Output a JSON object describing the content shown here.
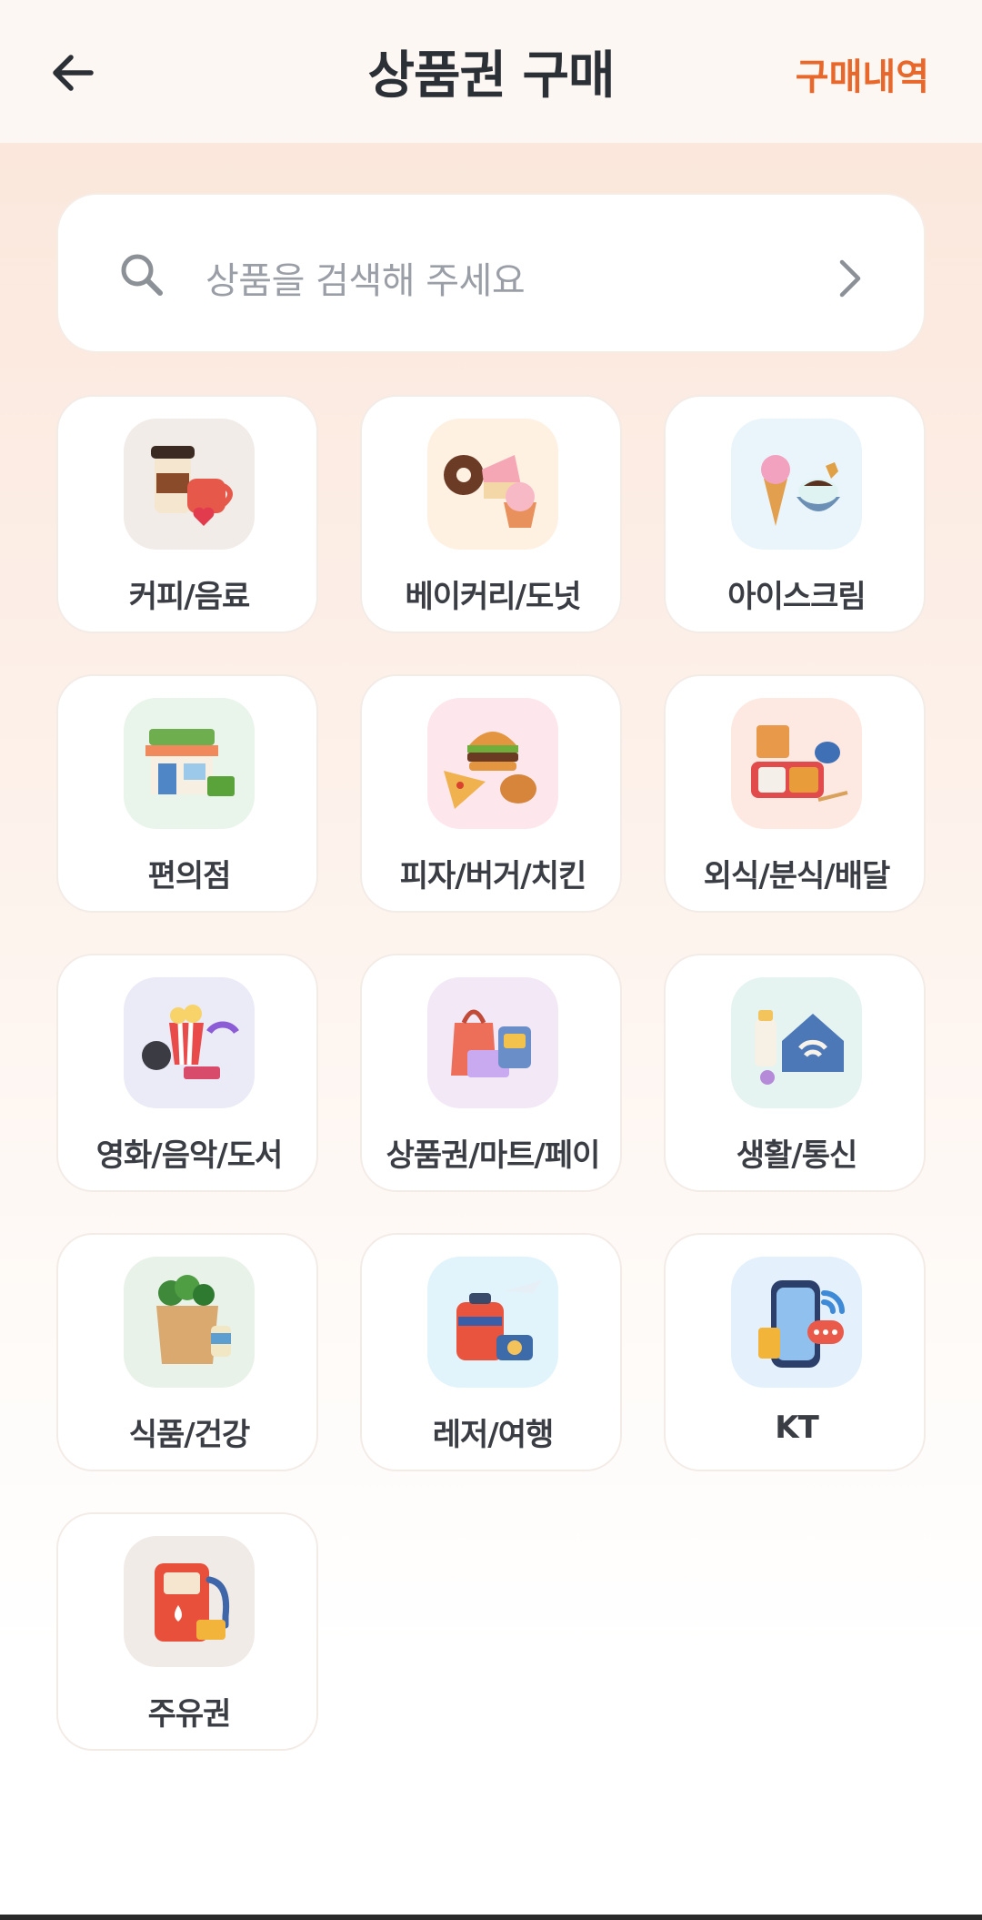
{
  "header": {
    "title": "상품권 구매",
    "back_icon": "arrow-left-icon",
    "history_label": "구매내역",
    "accent_color": "#e8672a"
  },
  "search": {
    "placeholder": "상품을 검색해 주세요",
    "icon": "search-icon",
    "arrow_icon": "chevron-right-icon"
  },
  "categories": [
    {
      "label": "커피/음료",
      "icon": "coffee-cup-icon",
      "bg": "#f2ece8"
    },
    {
      "label": "베이커리/도넛",
      "icon": "donut-cake-icon",
      "bg": "#fff1e2"
    },
    {
      "label": "아이스크림",
      "icon": "ice-cream-icon",
      "bg": "#eaf5fb"
    },
    {
      "label": "편의점",
      "icon": "store-icon",
      "bg": "#e9f4ea"
    },
    {
      "label": "피자/버거/치킨",
      "icon": "burger-pizza-icon",
      "bg": "#fde6ec"
    },
    {
      "label": "외식/분식/배달",
      "icon": "lunchbox-icon",
      "bg": "#fde9e2"
    },
    {
      "label": "영화/음악/도서",
      "icon": "popcorn-film-icon",
      "bg": "#ebebf8"
    },
    {
      "label": "상품권/마트/페이",
      "icon": "shopping-bag-icon",
      "bg": "#f2e8f6"
    },
    {
      "label": "생활/통신",
      "icon": "home-wifi-icon",
      "bg": "#e5f3f1"
    },
    {
      "label": "식품/건강",
      "icon": "grocery-bag-icon",
      "bg": "#e9f2e8"
    },
    {
      "label": "레저/여행",
      "icon": "suitcase-plane-icon",
      "bg": "#e2f4fb"
    },
    {
      "label": "KT",
      "icon": "smartphone-icon",
      "bg": "#e4f1fc"
    },
    {
      "label": "주유권",
      "icon": "fuel-pump-icon",
      "bg": "#f1ebe8"
    }
  ]
}
